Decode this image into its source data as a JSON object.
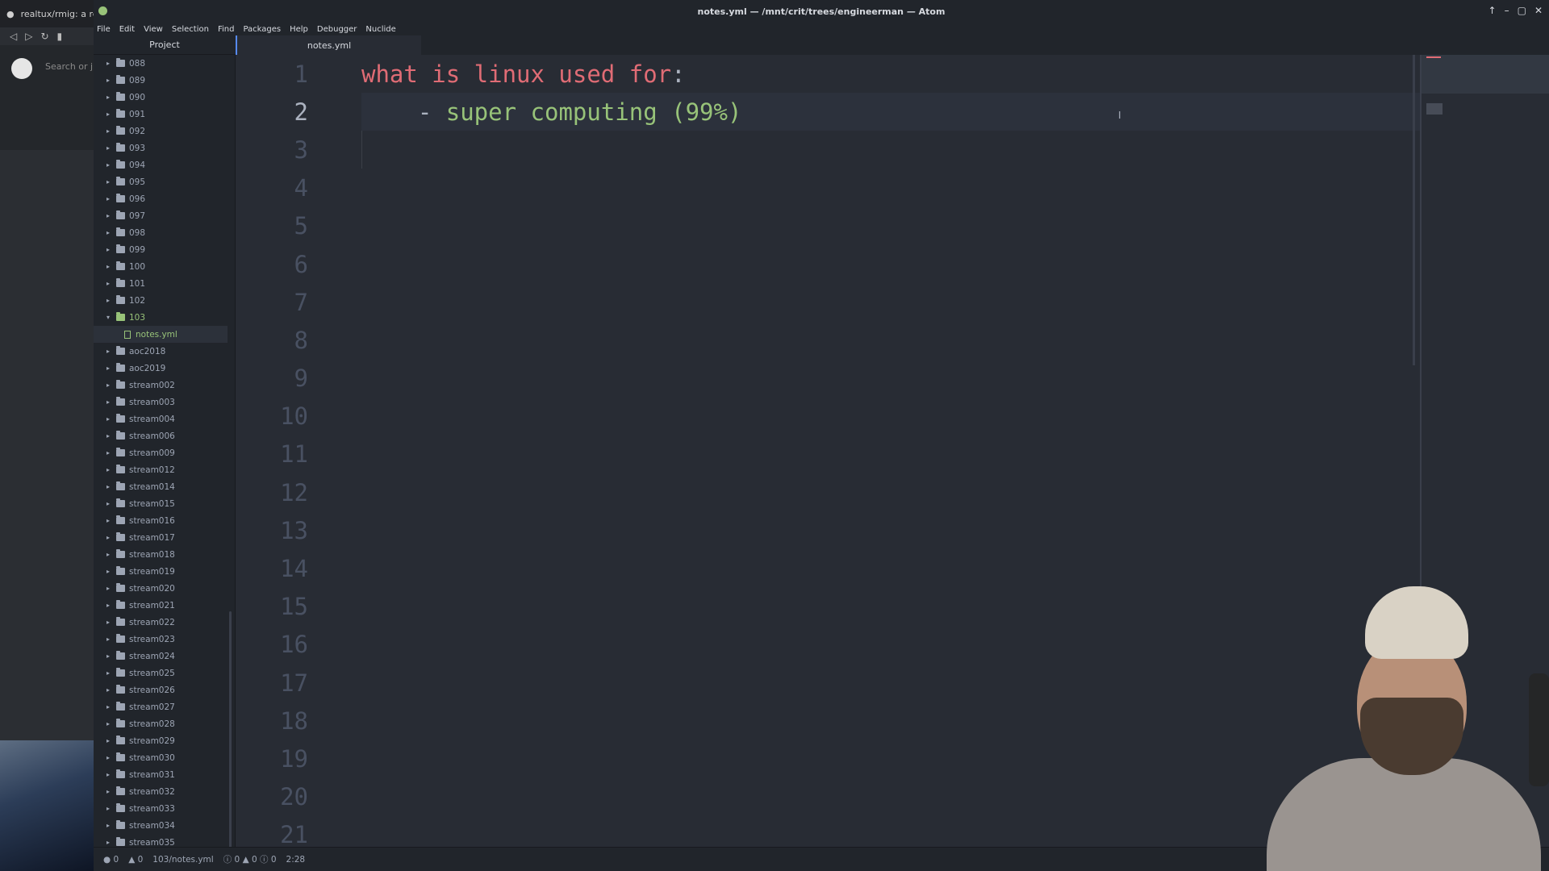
{
  "browser": {
    "tab_title": "realtux/rmig: a reim",
    "search_placeholder": "Search or ju"
  },
  "window": {
    "title": "notes.yml — /mnt/crit/trees/engineerman — Atom",
    "controls": [
      "↑",
      "–",
      "▢",
      "✕"
    ]
  },
  "menu": [
    "File",
    "Edit",
    "View",
    "Selection",
    "Find",
    "Packages",
    "Help",
    "Debugger",
    "Nuclide"
  ],
  "sidebar": {
    "header": "Project",
    "items": [
      {
        "label": "088",
        "type": "folder"
      },
      {
        "label": "089",
        "type": "folder"
      },
      {
        "label": "090",
        "type": "folder"
      },
      {
        "label": "091",
        "type": "folder"
      },
      {
        "label": "092",
        "type": "folder"
      },
      {
        "label": "093",
        "type": "folder"
      },
      {
        "label": "094",
        "type": "folder"
      },
      {
        "label": "095",
        "type": "folder"
      },
      {
        "label": "096",
        "type": "folder"
      },
      {
        "label": "097",
        "type": "folder"
      },
      {
        "label": "098",
        "type": "folder"
      },
      {
        "label": "099",
        "type": "folder"
      },
      {
        "label": "100",
        "type": "folder"
      },
      {
        "label": "101",
        "type": "folder"
      },
      {
        "label": "102",
        "type": "folder"
      },
      {
        "label": "103",
        "type": "folder-open"
      },
      {
        "label": "notes.yml",
        "type": "file-selected"
      },
      {
        "label": "aoc2018",
        "type": "folder"
      },
      {
        "label": "aoc2019",
        "type": "folder"
      },
      {
        "label": "stream002",
        "type": "folder"
      },
      {
        "label": "stream003",
        "type": "folder"
      },
      {
        "label": "stream004",
        "type": "folder"
      },
      {
        "label": "stream006",
        "type": "folder"
      },
      {
        "label": "stream009",
        "type": "folder"
      },
      {
        "label": "stream012",
        "type": "folder"
      },
      {
        "label": "stream014",
        "type": "folder"
      },
      {
        "label": "stream015",
        "type": "folder"
      },
      {
        "label": "stream016",
        "type": "folder"
      },
      {
        "label": "stream017",
        "type": "folder"
      },
      {
        "label": "stream018",
        "type": "folder"
      },
      {
        "label": "stream019",
        "type": "folder"
      },
      {
        "label": "stream020",
        "type": "folder"
      },
      {
        "label": "stream021",
        "type": "folder"
      },
      {
        "label": "stream022",
        "type": "folder"
      },
      {
        "label": "stream023",
        "type": "folder"
      },
      {
        "label": "stream024",
        "type": "folder"
      },
      {
        "label": "stream025",
        "type": "folder"
      },
      {
        "label": "stream026",
        "type": "folder"
      },
      {
        "label": "stream027",
        "type": "folder"
      },
      {
        "label": "stream028",
        "type": "folder"
      },
      {
        "label": "stream029",
        "type": "folder"
      },
      {
        "label": "stream030",
        "type": "folder"
      },
      {
        "label": "stream031",
        "type": "folder"
      },
      {
        "label": "stream032",
        "type": "folder"
      },
      {
        "label": "stream033",
        "type": "folder"
      },
      {
        "label": "stream034",
        "type": "folder"
      },
      {
        "label": "stream035",
        "type": "folder"
      }
    ]
  },
  "tabs": [
    {
      "label": "notes.yml",
      "active": true
    }
  ],
  "editor": {
    "line_numbers": [
      "1",
      "2",
      "3",
      "4",
      "5",
      "6",
      "7",
      "8",
      "9",
      "10",
      "11",
      "12",
      "13",
      "14",
      "15",
      "16",
      "17",
      "18",
      "19",
      "20",
      "21"
    ],
    "active_line": 2,
    "code": [
      {
        "key": "what is linux used for",
        "punc": ":"
      },
      {
        "indent": "    ",
        "dash": "- ",
        "value": "super computing (99%)"
      }
    ]
  },
  "statusbar": {
    "errors": "0",
    "warnings": "0",
    "file_path": "103/notes.yml",
    "diagnostics": "0 ▲ 0 ⓘ 0",
    "cursor_position": "2:28"
  },
  "colors": {
    "key": "#e06c75",
    "string": "#98c379",
    "background": "#282c34",
    "panel": "#21252b",
    "accent": "#568af2"
  }
}
